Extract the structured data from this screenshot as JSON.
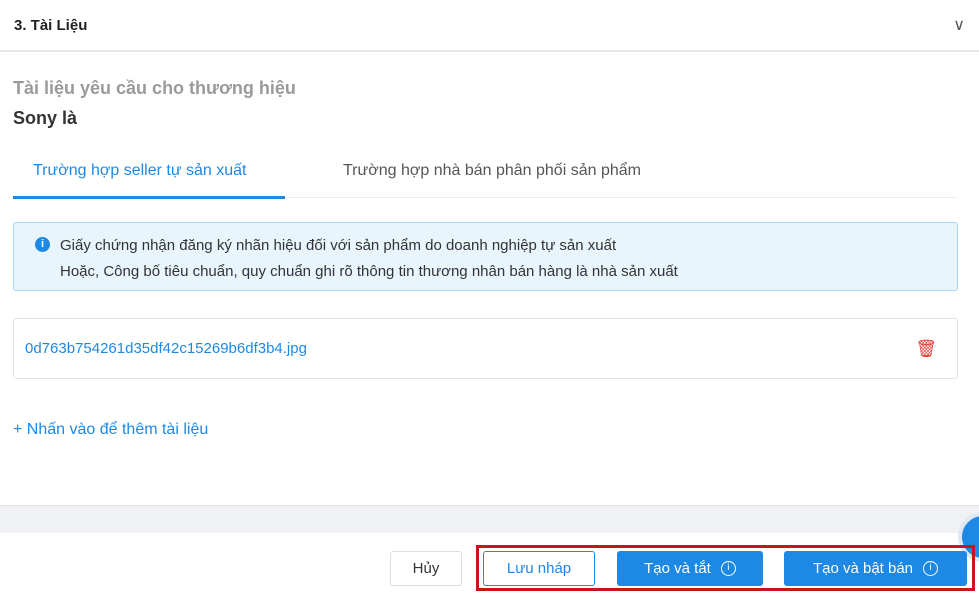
{
  "section": {
    "title": "3. Tài Liệu"
  },
  "docs": {
    "subtitle": "Tài liệu yêu cầu cho thương hiệu",
    "brand": "Sony là"
  },
  "tabs": [
    {
      "label": "Trường hợp seller tự sản xuất",
      "active": true
    },
    {
      "label": "Trường hợp nhà bán phân phối sản phẩm",
      "active": false
    }
  ],
  "info": {
    "line1": "Giấy chứng nhận đăng ký nhãn hiệu đối với sản phẩm do doanh nghiệp tự sản xuất",
    "line2": "Hoặc, Công bố tiêu chuẩn, quy chuẩn ghi rõ thông tin thương nhân bán hàng là nhà sản xuất"
  },
  "file": {
    "name": "0d763b754261d35df42c15269b6df3b4.jpg"
  },
  "add_label": "+ Nhấn vào để thêm tài liệu",
  "footer": {
    "cancel": "Hủy",
    "draft": "Lưu nháp",
    "create_off": "Tạo và tắt",
    "create_on": "Tạo và bật bán"
  }
}
